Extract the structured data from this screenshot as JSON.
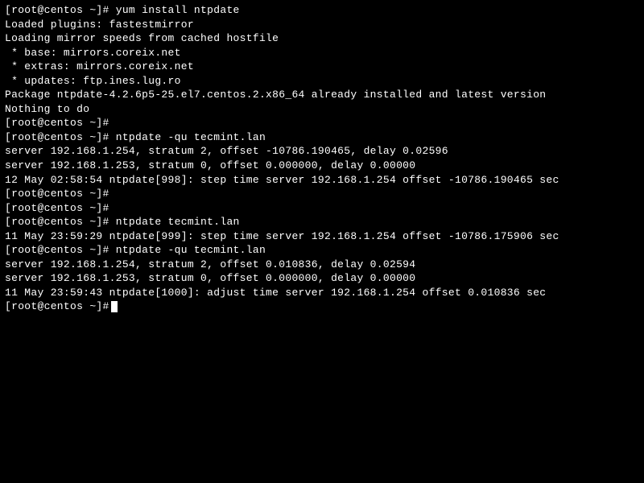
{
  "lines": [
    "[root@centos ~]# yum install ntpdate",
    "Loaded plugins: fastestmirror",
    "Loading mirror speeds from cached hostfile",
    " * base: mirrors.coreix.net",
    " * extras: mirrors.coreix.net",
    " * updates: ftp.ines.lug.ro",
    "Package ntpdate-4.2.6p5-25.el7.centos.2.x86_64 already installed and latest version",
    "Nothing to do",
    "[root@centos ~]#",
    "[root@centos ~]# ntpdate -qu tecmint.lan",
    "server 192.168.1.254, stratum 2, offset -10786.190465, delay 0.02596",
    "server 192.168.1.253, stratum 0, offset 0.000000, delay 0.00000",
    "12 May 02:58:54 ntpdate[998]: step time server 192.168.1.254 offset -10786.190465 sec",
    "[root@centos ~]#",
    "[root@centos ~]#",
    "[root@centos ~]# ntpdate tecmint.lan",
    "11 May 23:59:29 ntpdate[999]: step time server 192.168.1.254 offset -10786.175906 sec",
    "[root@centos ~]# ntpdate -qu tecmint.lan",
    "server 192.168.1.254, stratum 2, offset 0.010836, delay 0.02594",
    "server 192.168.1.253, stratum 0, offset 0.000000, delay 0.00000",
    "11 May 23:59:43 ntpdate[1000]: adjust time server 192.168.1.254 offset 0.010836 sec",
    "[root@centos ~]#"
  ],
  "cursor_visible": true
}
